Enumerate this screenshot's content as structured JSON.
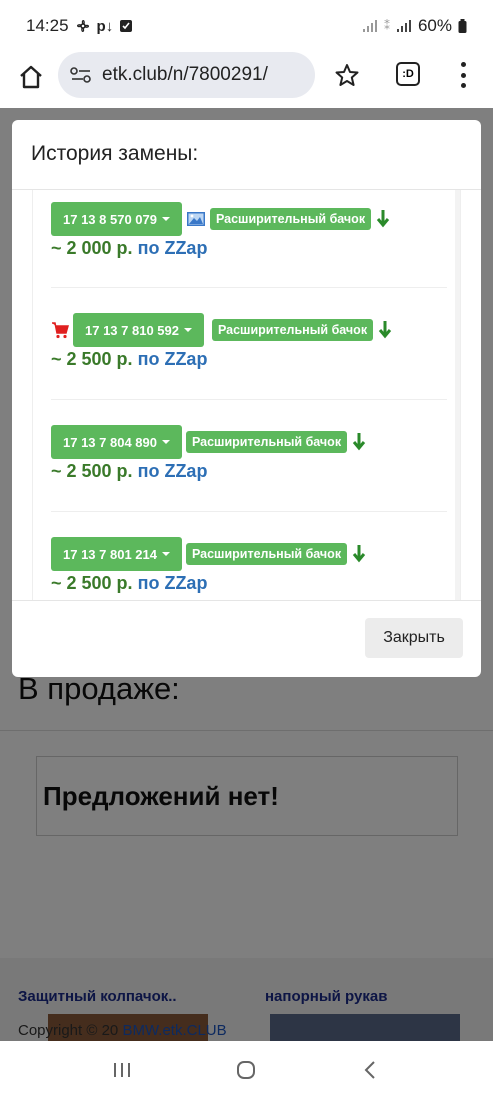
{
  "status_bar": {
    "time": "14:25",
    "battery": "60%"
  },
  "browser": {
    "url": "etk.club/n/7800291/"
  },
  "page": {
    "sale_title": "В продаже:",
    "no_offers": "Предложений нет!",
    "related": [
      {
        "title": "Защитный колпачок.."
      },
      {
        "title": "напорный рукав"
      }
    ],
    "copyright_prefix": "Copyright © 20",
    "copyright_link": "BMW.etk.CLUB"
  },
  "modal": {
    "title": "История замены:",
    "close_label": "Закрыть",
    "items": [
      {
        "part_number": "17 13 8 570 079",
        "label": "Расширительный бачок",
        "price": "~ 2 000 р.",
        "source": "по ZZap",
        "icon": "image-icon"
      },
      {
        "part_number": "17 13 7 810 592",
        "label": "Расширительный бачок",
        "price": "~ 2 500 р.",
        "source": "по ZZap",
        "icon": "cart-icon"
      },
      {
        "part_number": "17 13 7 804 890",
        "label": "Расширительный бачок",
        "price": "~ 2 500 р.",
        "source": "по ZZap",
        "icon": ""
      },
      {
        "part_number": "17 13 7 801 214",
        "label": "Расширительный бачок",
        "price": "~ 2 500 р.",
        "source": "по ZZap",
        "icon": ""
      }
    ]
  },
  "colors": {
    "accent_green": "#5cb85c",
    "link_blue": "#2d6fb5",
    "cart_red": "#e02020"
  }
}
